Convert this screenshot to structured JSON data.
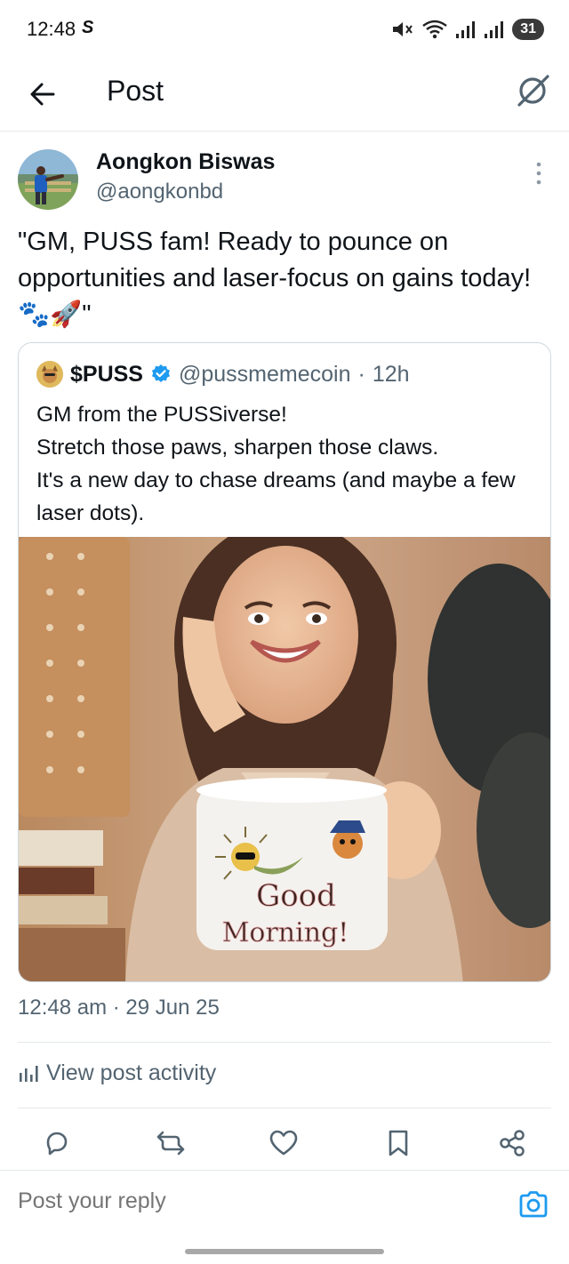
{
  "status_bar": {
    "time": "12:48",
    "carrier_glyph": "S",
    "battery": "31",
    "icons": [
      "mute-icon",
      "wifi-icon",
      "signal-icon",
      "signal-icon",
      "battery-icon"
    ]
  },
  "header": {
    "title": "Post",
    "back_icon": "arrow-left-icon",
    "grok_icon": "grok-icon"
  },
  "post": {
    "author_name": "Aongkon Biswas",
    "author_handle": "@aongkonbd",
    "text": "\"GM, PUSS fam! Ready to pounce on opportunities and laser-focus on gains today! 🐾🚀\"",
    "timestamp": "12:48 am · 29 Jun 25"
  },
  "quote": {
    "name": "$PUSS",
    "handle": "@pussmemecoin",
    "separator": "·",
    "age": "12h",
    "text": "GM from the PUSSiverse!\nStretch those paws, sharpen those claws.\nIt's a new day to chase dreams (and maybe a few laser dots).",
    "verified_icon": "verified-badge-icon"
  },
  "media": {
    "mug_text_line1": "Good",
    "mug_text_line2": "Morning!"
  },
  "activity": {
    "label": "View post activity",
    "icon": "bar-chart-icon"
  },
  "actions": [
    "reply-icon",
    "repost-icon",
    "like-icon",
    "bookmark-icon",
    "share-icon"
  ],
  "reply": {
    "placeholder": "Post your reply",
    "camera_icon": "camera-icon"
  },
  "colors": {
    "text_primary": "#0f1419",
    "text_secondary": "#536471",
    "accent": "#1d9bf0",
    "border": "#cfd9de"
  }
}
